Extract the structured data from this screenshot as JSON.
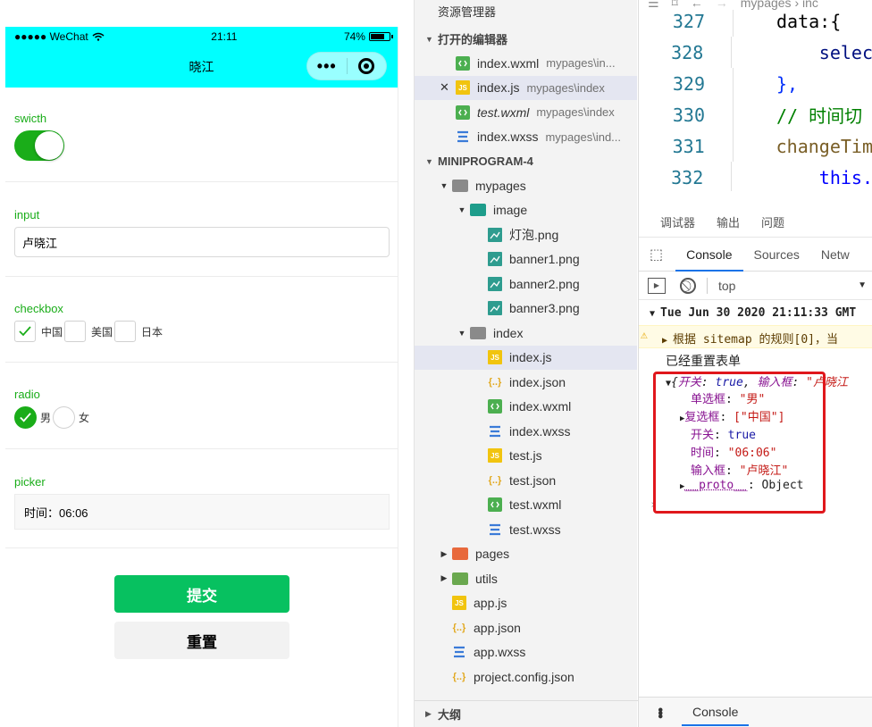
{
  "phone": {
    "status": {
      "carrier": "●●●●● WeChat",
      "time": "21:11",
      "battery": "74%",
      "battery_level": 0.74
    },
    "nav_title": "晓江",
    "capsule": {
      "more": "•••"
    },
    "switch": {
      "label": "swicth",
      "on": true
    },
    "input": {
      "label": "input",
      "value": "卢晓江"
    },
    "checkbox": {
      "label": "checkbox",
      "options": [
        {
          "text": "中国",
          "checked": true
        },
        {
          "text": "美国",
          "checked": false
        },
        {
          "text": "日本",
          "checked": false
        }
      ]
    },
    "radio": {
      "label": "radio",
      "options": [
        {
          "text": "男",
          "checked": true
        },
        {
          "text": "女",
          "checked": false
        }
      ]
    },
    "picker": {
      "label": "picker",
      "value": "时间：06:06"
    },
    "submit_label": "提交",
    "reset_label": "重置"
  },
  "explorer": {
    "title": "资源管理器",
    "open_editors_label": "打开的编辑器",
    "open_editors": [
      {
        "name": "index.wxml",
        "path": "mypages\\in...",
        "type": "wxml"
      },
      {
        "name": "index.js",
        "path": "mypages\\index",
        "type": "js",
        "active": true
      },
      {
        "name": "test.wxml",
        "path": "mypages\\index",
        "type": "wxml"
      },
      {
        "name": "index.wxss",
        "path": "mypages\\ind...",
        "type": "wxss"
      }
    ],
    "project_label": "MINIPROGRAM-4",
    "tree": [
      {
        "name": "mypages",
        "type": "folder",
        "depth": 0,
        "arrow": "▾",
        "color": "#8a8a8a"
      },
      {
        "name": "image",
        "type": "folder",
        "depth": 1,
        "arrow": "▾",
        "color": "#1e9d8b"
      },
      {
        "name": "灯泡.png",
        "type": "png",
        "depth": 2
      },
      {
        "name": "banner1.png",
        "type": "png",
        "depth": 2
      },
      {
        "name": "banner2.png",
        "type": "png",
        "depth": 2
      },
      {
        "name": "banner3.png",
        "type": "png",
        "depth": 2
      },
      {
        "name": "index",
        "type": "folder",
        "depth": 1,
        "arrow": "▾",
        "color": "#8a8a8a"
      },
      {
        "name": "index.js",
        "type": "js",
        "depth": 2,
        "selected": true
      },
      {
        "name": "index.json",
        "type": "json",
        "depth": 2
      },
      {
        "name": "index.wxml",
        "type": "wxml",
        "depth": 2
      },
      {
        "name": "index.wxss",
        "type": "wxss",
        "depth": 2
      },
      {
        "name": "test.js",
        "type": "js",
        "depth": 2
      },
      {
        "name": "test.json",
        "type": "json",
        "depth": 2
      },
      {
        "name": "test.wxml",
        "type": "wxml",
        "depth": 2
      },
      {
        "name": "test.wxss",
        "type": "wxss",
        "depth": 2
      },
      {
        "name": "pages",
        "type": "folder",
        "depth": 0,
        "arrow": "▸",
        "color": "#e8693c"
      },
      {
        "name": "utils",
        "type": "folder",
        "depth": 0,
        "arrow": "▸",
        "color": "#6aa84f"
      },
      {
        "name": "app.js",
        "type": "js",
        "depth": 0
      },
      {
        "name": "app.json",
        "type": "json",
        "depth": 0
      },
      {
        "name": "app.wxss",
        "type": "wxss",
        "depth": 0
      },
      {
        "name": "project.config.json",
        "type": "json",
        "depth": 0
      }
    ],
    "outline_label": "大纲"
  },
  "editor": {
    "breadcrumb": "mypages › inc",
    "lines": [
      {
        "num": "327",
        "text": "data:{",
        "indent": 0,
        "color": "#000000"
      },
      {
        "num": "328",
        "text": "selec",
        "indent": 1,
        "color": "#001080"
      },
      {
        "num": "329",
        "text": "},",
        "indent": 0,
        "color": "#0431fa"
      },
      {
        "num": "330",
        "text": "// 时间切",
        "indent": 0,
        "color": "#008000"
      },
      {
        "num": "331",
        "text": "changeTim",
        "indent": 0,
        "color": "#795e26"
      },
      {
        "num": "332",
        "text": "this.",
        "indent": 1,
        "color": "#0000ff"
      }
    ]
  },
  "devtools": {
    "top_tabs": [
      "调试器",
      "输出",
      "问题"
    ],
    "tabs": [
      "Console",
      "Sources",
      "Netw"
    ],
    "context": "top",
    "console": {
      "date_line": "Tue Jun 30 2020 21:11:33 GMT",
      "warning": "根据 sitemap 的规则[0]，当",
      "reset_msg": "已经重置表单",
      "obj_summary_k1": "开关",
      "obj_summary_v1": "true",
      "obj_summary_k2": "输入框",
      "obj_summary_v2": "\"卢晓江",
      "props": [
        {
          "key": "单选框",
          "value": "\"男\"",
          "kind": "str",
          "expandable": false
        },
        {
          "key": "复选框",
          "value": "[\"中国\"]",
          "kind": "str",
          "expandable": true
        },
        {
          "key": "开关",
          "value": "true",
          "kind": "num",
          "expandable": false
        },
        {
          "key": "时间",
          "value": "\"06:06\"",
          "kind": "str",
          "expandable": false
        },
        {
          "key": "输入框",
          "value": "\"卢晓江\"",
          "kind": "str",
          "expandable": false
        },
        {
          "key": "__proto__",
          "value": "Object",
          "kind": "plain",
          "expandable": true
        }
      ]
    },
    "bottom_tab": "Console"
  },
  "colors": {
    "accent_green": "#1aad19",
    "primary_button": "#07c160",
    "nav_cyan": "#00ffff",
    "highlight_box": "#e0171c"
  }
}
